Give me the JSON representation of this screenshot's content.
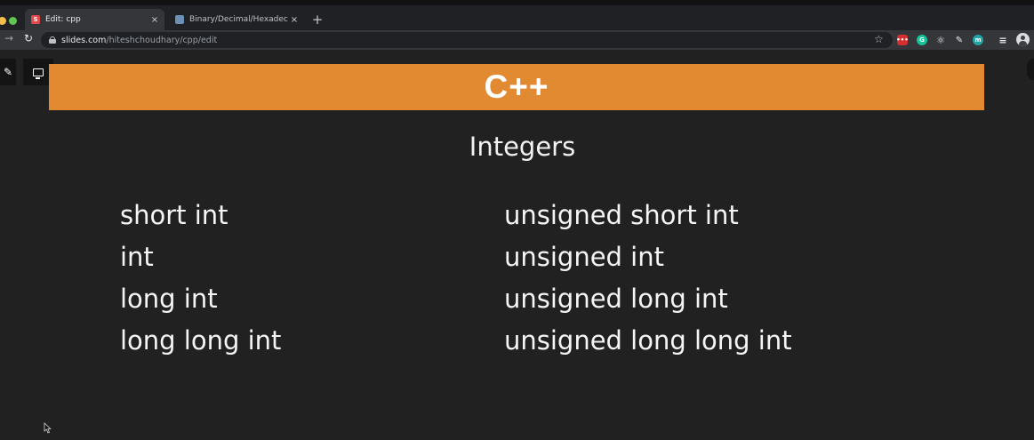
{
  "browser": {
    "tabs": [
      {
        "title": "Edit: cpp",
        "favicon": "slides-favicon",
        "active": true
      },
      {
        "title": "Binary/Decimal/Hexadecimal C",
        "favicon": "binary-converter-favicon",
        "active": false
      }
    ],
    "new_tab_label": "+",
    "close_glyph": "×",
    "url_host": "slides.com",
    "url_path": "/hiteshchoudhary/cpp/edit"
  },
  "slide": {
    "header": "C++",
    "header_color": "#e28a31",
    "subtitle": "Integers",
    "left_column": [
      "short int",
      "int",
      "long int",
      "long long int"
    ],
    "right_column": [
      "unsigned short int",
      "unsigned int",
      "unsigned long int",
      "unsigned long long int"
    ]
  }
}
